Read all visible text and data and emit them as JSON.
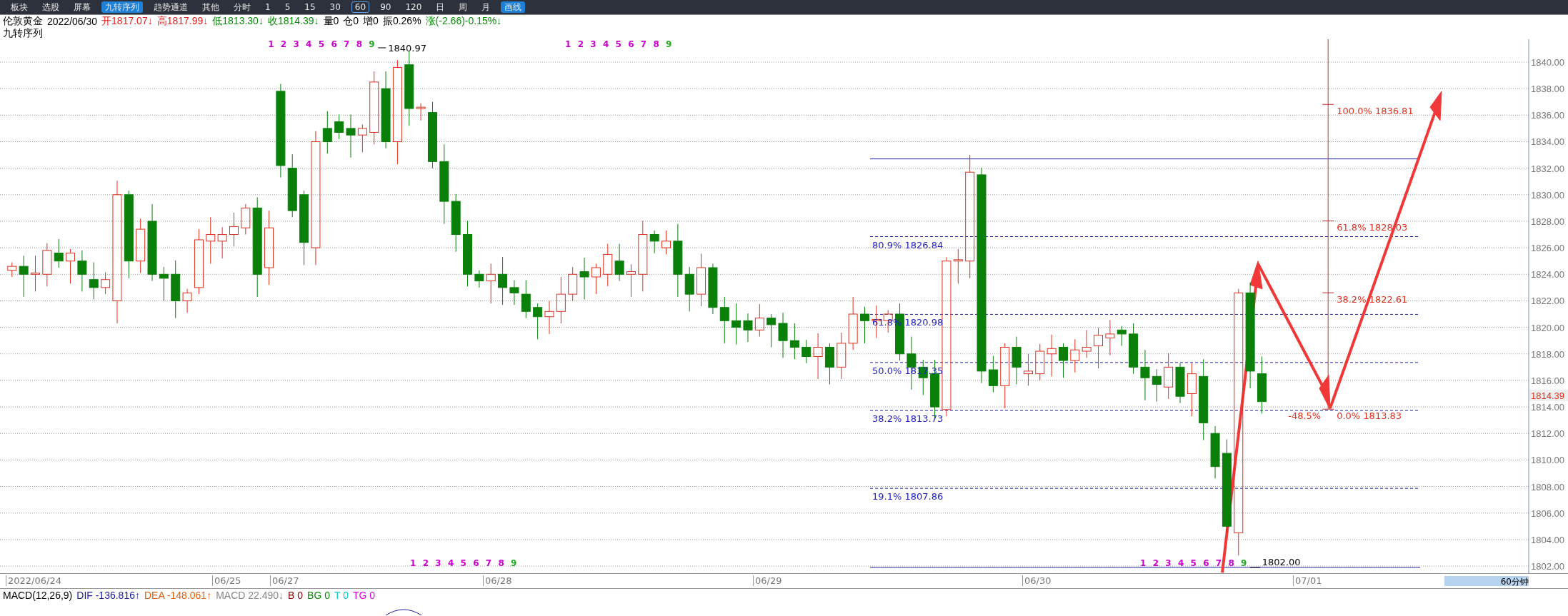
{
  "toolbar": {
    "items": [
      {
        "label": "板块",
        "kind": "tool",
        "selected": false
      },
      {
        "label": "选股",
        "kind": "tool",
        "selected": false
      },
      {
        "label": "屏幕",
        "kind": "tool",
        "selected": false
      },
      {
        "label": "九转序列",
        "kind": "tool",
        "selected": true
      },
      {
        "label": "趋势通道",
        "kind": "tool",
        "selected": false
      },
      {
        "label": "其他",
        "kind": "tool",
        "selected": false
      },
      {
        "label": "分时",
        "kind": "period",
        "selected": false
      },
      {
        "label": "1",
        "kind": "period",
        "selected": false
      },
      {
        "label": "5",
        "kind": "period",
        "selected": false
      },
      {
        "label": "15",
        "kind": "period",
        "selected": false
      },
      {
        "label": "30",
        "kind": "period",
        "selected": false
      },
      {
        "label": "60",
        "kind": "period",
        "selected": true
      },
      {
        "label": "90",
        "kind": "period",
        "selected": false
      },
      {
        "label": "120",
        "kind": "period",
        "selected": false
      },
      {
        "label": "日",
        "kind": "period",
        "selected": false
      },
      {
        "label": "周",
        "kind": "period",
        "selected": false
      },
      {
        "label": "月",
        "kind": "period",
        "selected": false
      },
      {
        "label": "画线",
        "kind": "tool",
        "selected": true
      }
    ]
  },
  "quote": {
    "name": "伦敦黄金",
    "date": "2022/06/30",
    "fields": [
      {
        "text": "开1817.07↓",
        "color": "#e0201e"
      },
      {
        "text": "高1817.99↓",
        "color": "#e0201e"
      },
      {
        "text": "低1813.30↓",
        "color": "#0a8a0a"
      },
      {
        "text": "收1814.39↓",
        "color": "#0a8a0a"
      },
      {
        "text": "量0",
        "color": "#000000"
      },
      {
        "text": "仓0",
        "color": "#000000"
      },
      {
        "text": "增0",
        "color": "#000000"
      },
      {
        "text": "振0.26%",
        "color": "#000000"
      },
      {
        "text": "涨(-2.66)-0.15%↓",
        "color": "#0a8a0a"
      }
    ]
  },
  "indicator_label": "九转序列",
  "chart": {
    "high_label": "1840.97",
    "low_label": "1802.00",
    "nine_sequences": [
      {
        "digits": [
          {
            "text": "1",
            "color": "#cc00cc"
          },
          {
            "text": "2",
            "color": "#cc00cc"
          },
          {
            "text": "3",
            "color": "#cc00cc"
          },
          {
            "text": "4",
            "color": "#cc00cc"
          },
          {
            "text": "5",
            "color": "#cc00cc"
          },
          {
            "text": "6",
            "color": "#cc00cc"
          },
          {
            "text": "7",
            "color": "#cc00cc"
          },
          {
            "text": "8",
            "color": "#cc00cc"
          },
          {
            "text": "9",
            "color": "#22aa22"
          }
        ]
      },
      {
        "digits": [
          {
            "text": "1",
            "color": "#cc00cc"
          },
          {
            "text": "2",
            "color": "#cc00cc"
          },
          {
            "text": "3",
            "color": "#cc00cc"
          },
          {
            "text": "4",
            "color": "#cc00cc"
          },
          {
            "text": "5",
            "color": "#cc00cc"
          },
          {
            "text": "6",
            "color": "#cc00cc"
          },
          {
            "text": "7",
            "color": "#cc00cc"
          },
          {
            "text": "8",
            "color": "#cc00cc"
          },
          {
            "text": "9",
            "color": "#22aa22"
          }
        ]
      },
      {
        "digits": [
          {
            "text": "1",
            "color": "#cc00cc"
          },
          {
            "text": "2",
            "color": "#cc00cc"
          },
          {
            "text": "3",
            "color": "#cc00cc"
          },
          {
            "text": "4",
            "color": "#cc00cc"
          },
          {
            "text": "5",
            "color": "#cc00cc"
          },
          {
            "text": "6",
            "color": "#cc00cc"
          },
          {
            "text": "7",
            "color": "#cc00cc"
          },
          {
            "text": "8",
            "color": "#cc00cc"
          },
          {
            "text": "9",
            "color": "#22aa22"
          }
        ]
      },
      {
        "digits": [
          {
            "text": "1",
            "color": "#cc00cc"
          },
          {
            "text": "2",
            "color": "#cc00cc"
          },
          {
            "text": "3",
            "color": "#cc00cc"
          },
          {
            "text": "4",
            "color": "#cc00cc"
          },
          {
            "text": "5",
            "color": "#cc00cc"
          },
          {
            "text": "6",
            "color": "#cc00cc"
          },
          {
            "text": "7",
            "color": "#cc00cc"
          },
          {
            "text": "8",
            "color": "#cc00cc"
          },
          {
            "text": "9",
            "color": "#22aa22"
          }
        ]
      }
    ],
    "fib_left": [
      "80.9% 1826.84",
      "61.8% 1820.98",
      "50.0% 1817.35",
      "38.2% 1813.73",
      "19.1% 1807.86"
    ],
    "fib_right": [
      "100.0% 1836.81",
      "61.8% 1828.03",
      "38.2% 1822.61",
      "0.0% 1813.83"
    ],
    "fib_right_extension": "-48.5%"
  },
  "price_axis": {
    "labels": [
      "1840.00",
      "1838.00",
      "1836.00",
      "1834.00",
      "1832.00",
      "1830.00",
      "1828.00",
      "1826.00",
      "1824.00",
      "1822.00",
      "1820.00",
      "1818.00",
      "1816.00",
      "1814.00",
      "1812.00",
      "1810.00",
      "1808.00",
      "1806.00",
      "1804.00",
      "1802.00"
    ],
    "current": "1814.39"
  },
  "time_axis": {
    "labels": [
      "2022/06/24",
      "06/25",
      "06/27",
      "06/28",
      "06/29",
      "06/30",
      "07/01"
    ],
    "period": "60分钟"
  },
  "macd": {
    "title": "MACD(12,26,9)",
    "values": [
      {
        "text": "DIF -136.816↑",
        "color": "#1a1aa0"
      },
      {
        "text": "DEA -148.061↑",
        "color": "#e06010"
      },
      {
        "text": "MACD 22.490↓",
        "color": "#888888"
      },
      {
        "text": "B 0",
        "color": "#880000"
      },
      {
        "text": "BG 0",
        "color": "#0a8a0a"
      },
      {
        "text": "T 0",
        "color": "#00cccc"
      },
      {
        "text": "TG 0",
        "color": "#dd00dd"
      }
    ]
  }
}
